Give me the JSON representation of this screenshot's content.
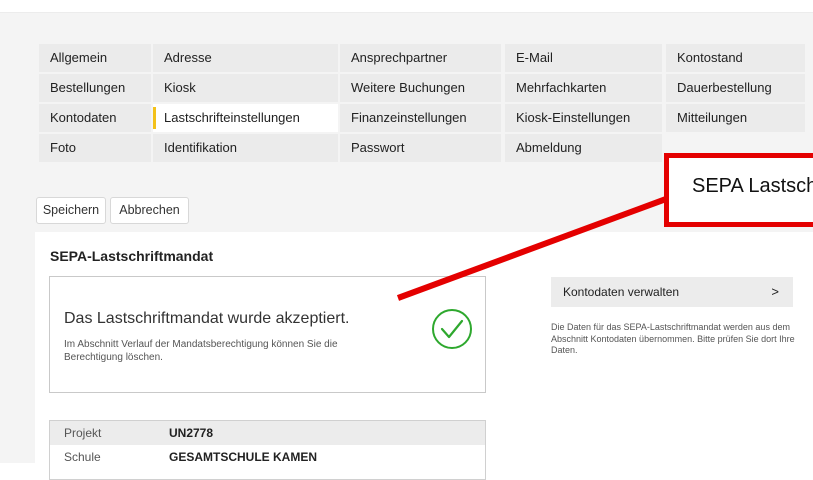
{
  "tabs": [
    [
      "Allgemein",
      "Adresse",
      "Ansprechpartner",
      "E-Mail",
      "Kontostand"
    ],
    [
      "Bestellungen",
      "Kiosk",
      "Weitere Buchungen",
      "Mehrfachkarten",
      "Dauerbestellung"
    ],
    [
      "Kontodaten",
      "Lastschrifteinstellungen",
      "Finanzeinstellungen",
      "Kiosk-Einstellungen",
      "Mitteilungen"
    ],
    [
      "Foto",
      "Identifikation",
      "Passwort",
      "Abmeldung"
    ]
  ],
  "active_tab": "Lastschrifteinstellungen",
  "buttons": {
    "save": "Speichern",
    "cancel": "Abbrechen"
  },
  "section": {
    "title": "SEPA-Lastschriftmandat",
    "status_heading": "Das Lastschriftmandat wurde akzeptiert.",
    "status_text": "Im Abschnitt Verlauf der Mandatsberechtigung können Sie die Berechtigung löschen.",
    "status_icon": "check-circle-icon",
    "status_color": "#2ea82e",
    "manage_button": "Kontodaten verwalten",
    "manage_chevron": ">",
    "manage_note": "Die Daten für das SEPA-Lastschriftmandat werden aus dem Abschnitt Kontodaten übernommen. Bitte prüfen Sie dort Ihre Daten."
  },
  "info": [
    {
      "label": "Projekt",
      "value": "UN2778"
    },
    {
      "label": "Schule",
      "value": "GESAMTSCHULE KAMEN"
    }
  ],
  "callout": {
    "text": "SEPA Lastschrift",
    "color": "#e40000"
  }
}
